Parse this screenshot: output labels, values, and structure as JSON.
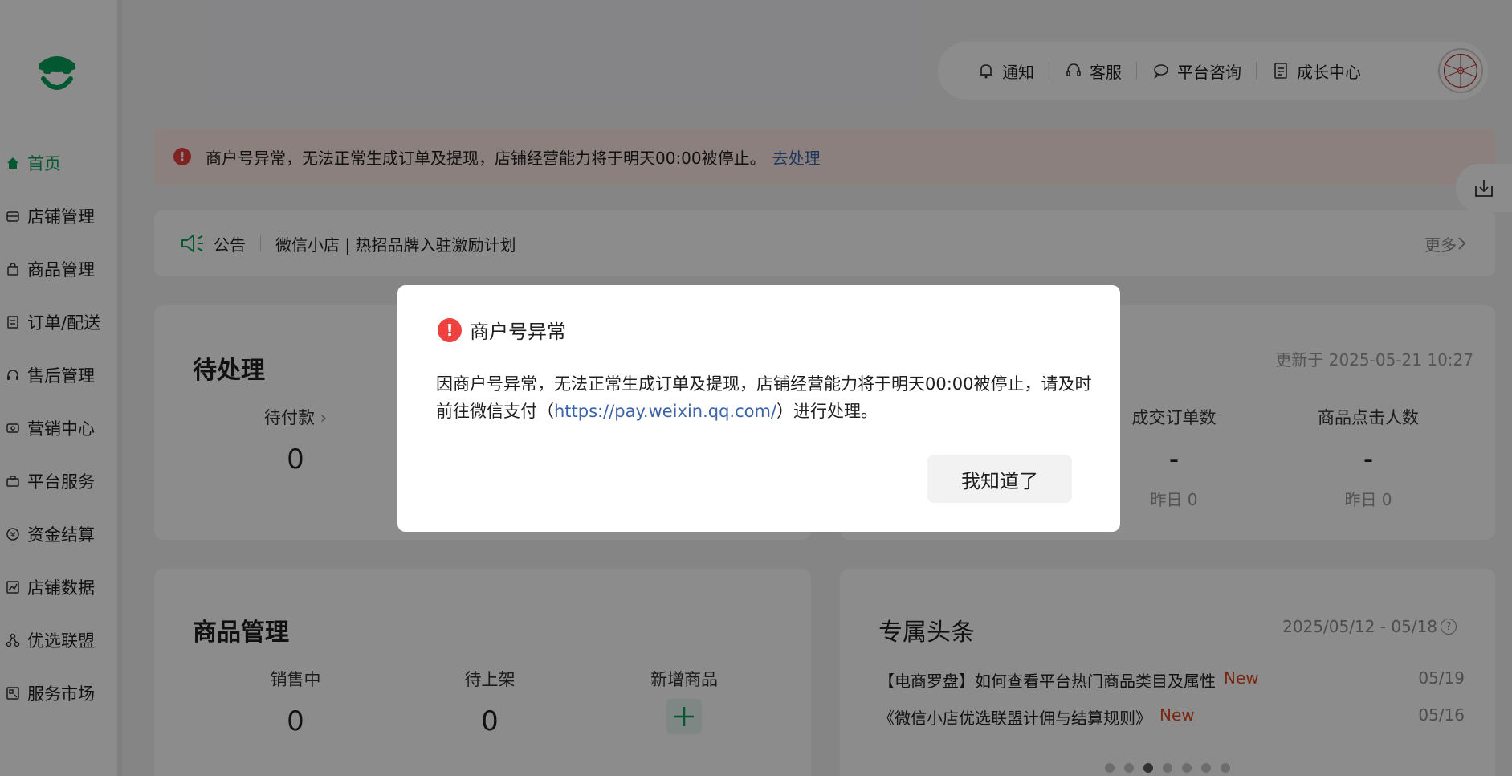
{
  "sidebar": {
    "items": [
      {
        "label": "首页",
        "icon": "home-icon",
        "active": true
      },
      {
        "label": "店铺管理",
        "icon": "store-icon"
      },
      {
        "label": "商品管理",
        "icon": "bag-icon"
      },
      {
        "label": "订单/配送",
        "icon": "order-icon"
      },
      {
        "label": "售后管理",
        "icon": "headset-icon"
      },
      {
        "label": "营销中心",
        "icon": "ticket-icon"
      },
      {
        "label": "平台服务",
        "icon": "briefcase-icon"
      },
      {
        "label": "资金结算",
        "icon": "yuan-icon"
      },
      {
        "label": "店铺数据",
        "icon": "chart-icon"
      },
      {
        "label": "优选联盟",
        "icon": "network-icon"
      },
      {
        "label": "服务市场",
        "icon": "market-icon"
      }
    ]
  },
  "topbar": {
    "notify": "通知",
    "service": "客服",
    "consult": "平台咨询",
    "growth": "成长中心"
  },
  "alert": {
    "text": "商户号异常，无法正常生成订单及提现，店铺经营能力将于明天00:00被停止。",
    "action": "去处理"
  },
  "notice": {
    "label": "公告",
    "text": "微信小店 | 热招品牌入驻激励计划",
    "more": "更多"
  },
  "pending": {
    "title": "待处理",
    "item_label": "待付款",
    "item_value": "0"
  },
  "business": {
    "updated": "更新于 2025-05-21 10:27",
    "orders_label": "成交订单数",
    "orders_value": "-",
    "orders_yesterday": "昨日 0",
    "clicks_label": "商品点击人数",
    "clicks_value": "-",
    "clicks_yesterday": "昨日 0"
  },
  "products": {
    "title": "商品管理",
    "on_sale_label": "销售中",
    "on_sale_value": "0",
    "pending_label": "待上架",
    "pending_value": "0",
    "add_label": "新增商品"
  },
  "headlines": {
    "title": "专属头条",
    "range": "2025/05/12 - 05/18",
    "items": [
      {
        "text": "【电商罗盘】如何查看平台热门商品类目及属性",
        "badge": "New",
        "date": "05/19"
      },
      {
        "text": "《微信小店优选联盟计佣与结算规则》",
        "badge": "New",
        "date": "05/16"
      }
    ]
  },
  "modal": {
    "title": "商户号异常",
    "body_pre": "因商户号异常，无法正常生成订单及提现，店铺经营能力将于明天00:00被停止，请及时前往微信支付（",
    "url": "https://pay.weixin.qq.com/",
    "body_post": "）进行处理。",
    "button": "我知道了"
  },
  "colors": {
    "accent": "#07a05b",
    "error": "#f04141",
    "link": "#3a63a8"
  }
}
